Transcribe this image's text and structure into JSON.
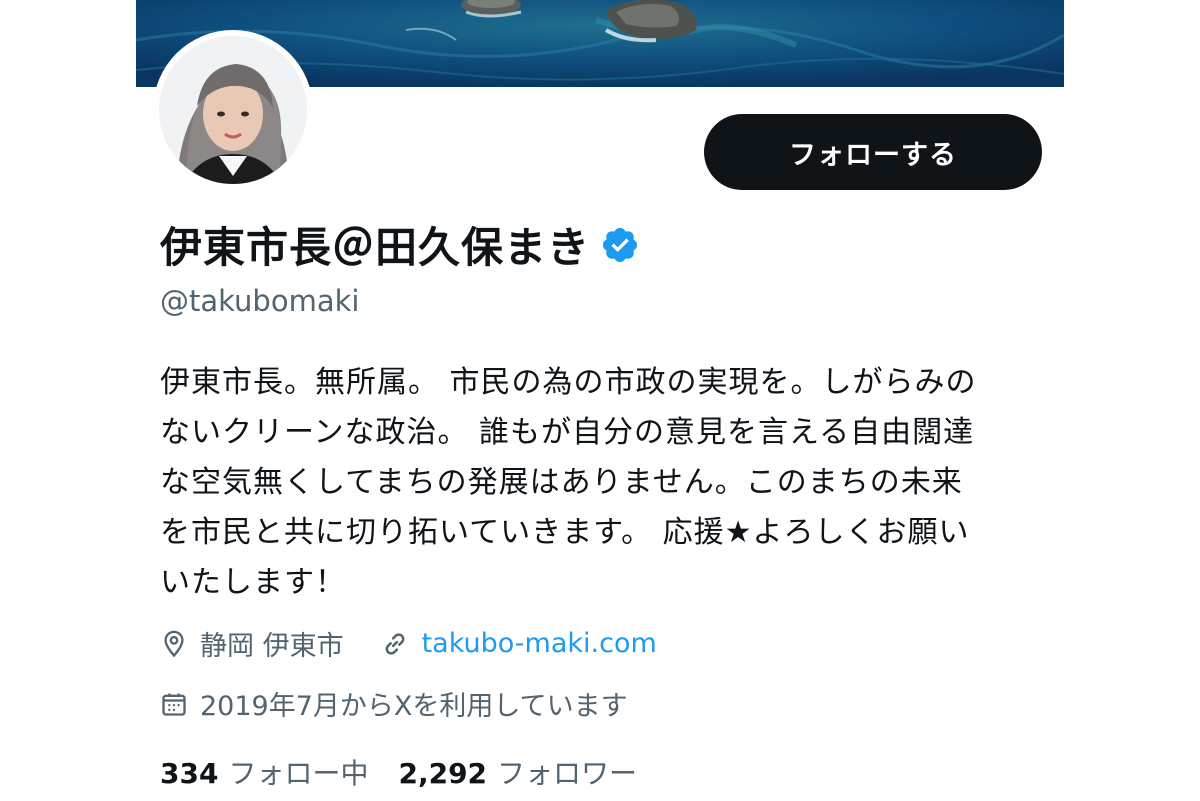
{
  "header": {
    "follow_button_label": "フォローする"
  },
  "profile": {
    "display_name": "伊東市長＠田久保まき",
    "handle": "@takubomaki",
    "verified": true,
    "bio": "伊東市長。無所属。 市民の為の市政の実現を。しがらみの\nないクリーンな政治。 誰もが自分の意見を言える自由闊達\nな空気無くしてまちの発展はありません。このまちの未来\nを市民と共に切り拓いていきます。 応援★よろしくお願い\nいたします！",
    "location": "静岡 伊東市",
    "website": "takubo-maki.com",
    "joined": "2019年7月からXを利用しています"
  },
  "stats": {
    "following_count": "334",
    "following_label": "フォロー中",
    "followers_count": "2,292",
    "followers_label": "フォロワー"
  },
  "icons": {
    "verified": "verified-badge-icon",
    "location": "location-pin-icon",
    "link": "link-icon",
    "calendar": "calendar-icon"
  },
  "colors": {
    "accent": "#1d9bf0",
    "button_bg": "#0f1419",
    "secondary_text": "#536471"
  }
}
